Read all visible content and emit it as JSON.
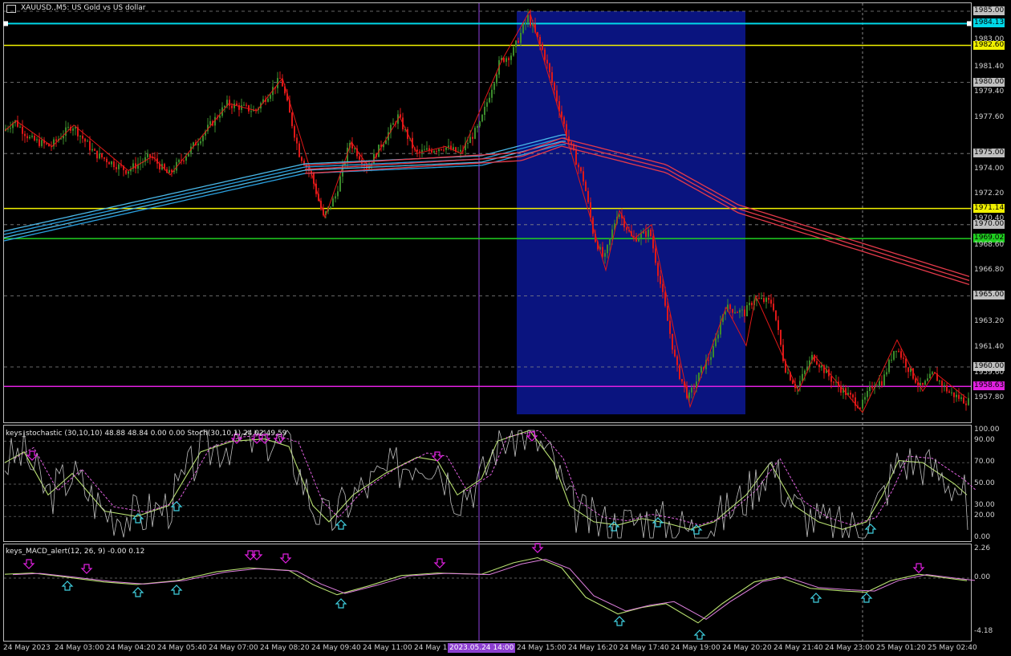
{
  "window": {
    "title": "XAUUSD.,M5: US Gold vs US dollar"
  },
  "colors": {
    "background": "#000000",
    "bull_candle": "#3c8c2c",
    "bear_candle": "#e01818",
    "zigzag": "#e01818",
    "highlight_box": "#0a147f",
    "ma_blue": "#4ab8e8",
    "ma_red": "#e63a4a",
    "cyan_line": "#00d8e8",
    "yellow_line": "#f0f000",
    "green_line": "#20d020",
    "magenta_line": "#e020e0"
  },
  "price_axis": {
    "ticks": [
      "1983.00",
      "1981.40",
      "1979.40",
      "1977.60",
      "1974.00",
      "1972.20",
      "1970.40",
      "1968.60",
      "1966.80",
      "1963.20",
      "1961.40",
      "1959.60",
      "1957.80"
    ],
    "tagged_levels": [
      {
        "value": "1985.00",
        "color": "#c0c0c0"
      },
      {
        "value": "1984.13",
        "color": "#00d8e8"
      },
      {
        "value": "1982.60",
        "color": "#f0f000"
      },
      {
        "value": "1980.00",
        "color": "#c0c0c0"
      },
      {
        "value": "1975.00",
        "color": "#c0c0c0"
      },
      {
        "value": "1971.14",
        "color": "#f0f000"
      },
      {
        "value": "1970.00",
        "color": "#c0c0c0"
      },
      {
        "value": "1969.02",
        "color": "#20d020"
      },
      {
        "value": "1965.00",
        "color": "#c0c0c0"
      },
      {
        "value": "1960.00",
        "color": "#c0c0c0"
      },
      {
        "value": "1958.63",
        "color": "#e020e0"
      }
    ]
  },
  "stochastic": {
    "label": "keys_stochastic (30,10,10) 48.88 48.84 0.00 0.00 Stoch(30,10,1) 24.02 49.59",
    "ticks": [
      "100.00",
      "90.00",
      "70.00",
      "50.00",
      "30.00",
      "20.00",
      "0.00"
    ]
  },
  "macd": {
    "label": "keys_MACD_alert(12, 26, 9) -0.00 0.12",
    "ticks": [
      "2.26",
      "0.00",
      "-4.18"
    ]
  },
  "time_axis": {
    "labels": [
      "24 May 2023",
      "24 May 03:00",
      "24 May 04:20",
      "24 May 05:40",
      "24 May 07:00",
      "24 May 08:20",
      "24 May 09:40",
      "24 May 11:00",
      "24 May 1",
      "24 May 15:00",
      "24 May 16:20",
      "24 May 17:40",
      "24 May 19:00",
      "24 May 20:20",
      "24 May 21:40",
      "24 May 23:00",
      "25 May 01:20",
      "25 May 02:40"
    ],
    "crosshair_date": "2023.05.24 14:00"
  }
}
